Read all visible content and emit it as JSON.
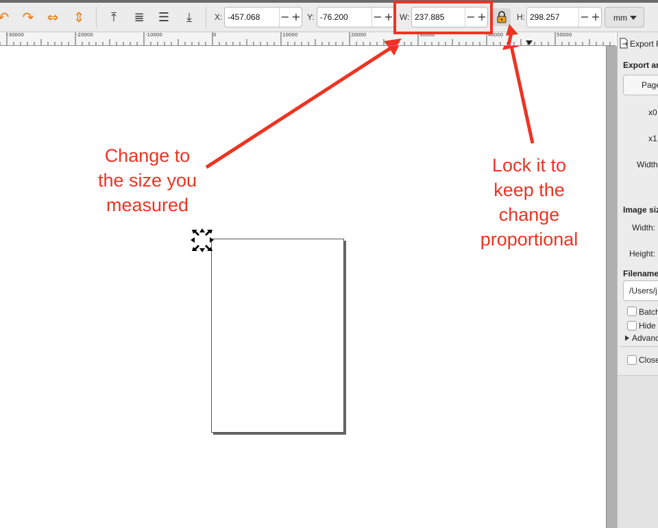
{
  "toolbar": {
    "x_label": "X:",
    "x_value": "-457.068",
    "y_label": "Y:",
    "y_value": "-76.200",
    "w_label": "W:",
    "w_value": "237.885",
    "h_label": "H:",
    "h_value": "298.257",
    "unit": "mm",
    "minus": "−",
    "plus": "+"
  },
  "ruler": {
    "labels": [
      "-30000",
      "-20000",
      "-10000",
      "0",
      "10000",
      "20000",
      "30000",
      "40000",
      "50000"
    ]
  },
  "panel": {
    "header_tab": "Export F",
    "export_area_label": "Export ar",
    "page_button": "Page",
    "x0_label": "x0",
    "x1_label": "x1",
    "width_label": "Width",
    "image_size_label": "Image siz",
    "img_width_label": "Width:",
    "img_height_label": "Height:",
    "filename_label": "Filename",
    "filename_value": "/Users/j",
    "batch_label": "Batch",
    "hide_label": "Hide",
    "advanced_label": "Advanc",
    "close_label": "Close"
  },
  "annotations": {
    "size_line1": "Change to",
    "size_line2": "the size you",
    "size_line3": "measured",
    "lock_line1": "Lock it to",
    "lock_line2": "keep the",
    "lock_line3": "change",
    "lock_line4": "proportional"
  },
  "colors": {
    "annotation_red": "#ee3323",
    "icon_orange": "#e57a10"
  }
}
